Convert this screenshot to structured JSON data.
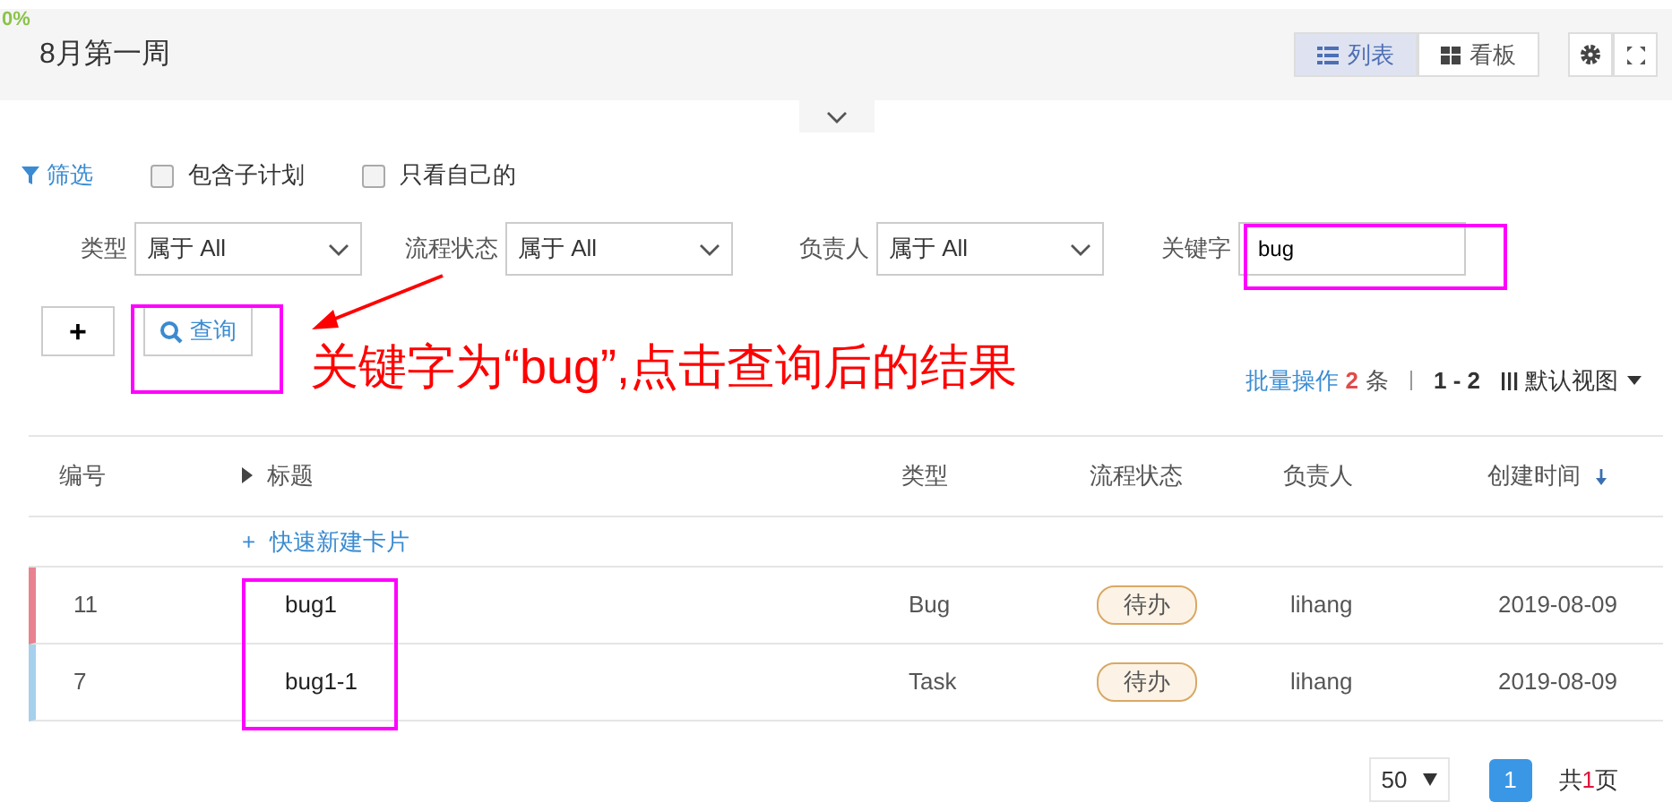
{
  "progress_label": "0%",
  "header": {
    "title": "8月第一周",
    "views": [
      {
        "label": "列表",
        "kind": "list",
        "selected": true
      },
      {
        "label": "看板",
        "kind": "board",
        "selected": false
      }
    ]
  },
  "filter_panel": {
    "expanded": false
  },
  "filter_bar": {
    "filter_label": "筛选",
    "checkboxes": [
      {
        "label": "包含子计划",
        "checked": false
      },
      {
        "label": "只看自己的",
        "checked": false
      }
    ]
  },
  "filters": [
    {
      "label": "类型",
      "kind": "select",
      "value": "属于 All"
    },
    {
      "label": "流程状态",
      "kind": "select",
      "value": "属于 All"
    },
    {
      "label": "负责人",
      "kind": "select",
      "value": "属于 All"
    },
    {
      "label": "关键字",
      "kind": "text",
      "value": "bug"
    }
  ],
  "add_button": "+",
  "search_button": "查询",
  "annotation": {
    "caption": "关键字为“bug”,点击查询后的结果"
  },
  "batch": {
    "label": "批量操作",
    "count": "2",
    "unit": "条",
    "range": "1 - 2",
    "view": "默认视图"
  },
  "table": {
    "columns": [
      "编号",
      "标题",
      "类型",
      "流程状态",
      "负责人",
      "创建时间"
    ],
    "quick_create_icon": "+",
    "quick_create": "快速新建卡片",
    "rows": [
      {
        "id": "11",
        "title": "bug1",
        "type": "Bug",
        "status": "待办",
        "assignee": "lihang",
        "created": "2019-08-09",
        "color": "#e8828f"
      },
      {
        "id": "7",
        "title": "bug1-1",
        "type": "Task",
        "status": "待办",
        "assignee": "lihang",
        "created": "2019-08-09",
        "color": "#a6d0ec"
      }
    ]
  },
  "pagination": {
    "page_size": "50",
    "pages": [
      {
        "label": "1",
        "selected": true
      }
    ],
    "total": {
      "prefix": "共",
      "count": "1",
      "suffix": "页"
    }
  }
}
